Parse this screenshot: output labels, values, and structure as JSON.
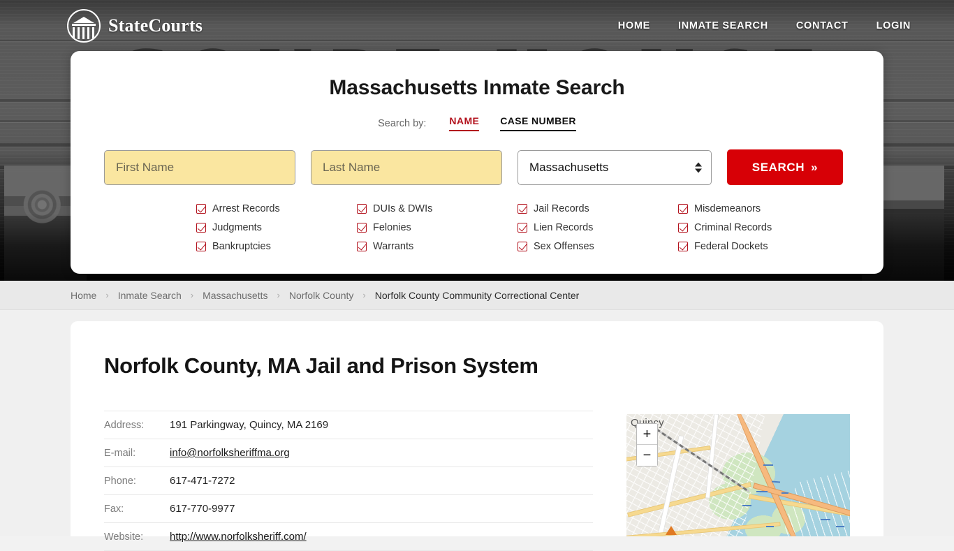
{
  "header": {
    "brand_name": "StateCourts",
    "logo_icon": "courthouse-circle-icon",
    "nav": [
      {
        "label": "HOME"
      },
      {
        "label": "INMATE SEARCH"
      },
      {
        "label": "CONTACT"
      },
      {
        "label": "LOGIN"
      }
    ],
    "background_word": "COURT HOUSE"
  },
  "search_card": {
    "title": "Massachusetts Inmate Search",
    "search_by_label": "Search by:",
    "tabs": [
      {
        "label": "NAME",
        "active": true
      },
      {
        "label": "CASE NUMBER",
        "active": false
      }
    ],
    "first_name": {
      "value": "",
      "placeholder": "First Name"
    },
    "last_name": {
      "value": "",
      "placeholder": "Last Name"
    },
    "state_select": {
      "value": "Massachusetts"
    },
    "search_button": {
      "label": "SEARCH",
      "chevron": "»"
    },
    "accent_red": "#d70006",
    "tab_red": "#b3121d",
    "field_fill": "#fae6a0",
    "records": [
      "Arrest Records",
      "DUIs & DWIs",
      "Jail Records",
      "Misdemeanors",
      "Judgments",
      "Felonies",
      "Lien Records",
      "Criminal Records",
      "Bankruptcies",
      "Warrants",
      "Sex Offenses",
      "Federal Dockets"
    ]
  },
  "breadcrumb": {
    "separator": "›",
    "items": [
      {
        "label": "Home",
        "current": false
      },
      {
        "label": "Inmate Search",
        "current": false
      },
      {
        "label": "Massachusetts",
        "current": false
      },
      {
        "label": "Norfolk County",
        "current": false
      },
      {
        "label": "Norfolk County Community Correctional Center",
        "current": true
      }
    ]
  },
  "main": {
    "page_title": "Norfolk County, MA Jail and Prison System",
    "details": [
      {
        "label": "Address:",
        "value": "191 Parkingway, Quincy, MA 2169",
        "link": false
      },
      {
        "label": "E-mail:",
        "value": "info@norfolksheriffma.org",
        "link": true
      },
      {
        "label": "Phone:",
        "value": "617-471-7272",
        "link": false
      },
      {
        "label": "Fax:",
        "value": "617-770-9977",
        "link": false
      },
      {
        "label": "Website:",
        "value": "http://www.norfolksheriff.com/",
        "link": true
      }
    ]
  },
  "map": {
    "place_label": "Quincy",
    "zoom_in": "+",
    "zoom_out": "−"
  }
}
